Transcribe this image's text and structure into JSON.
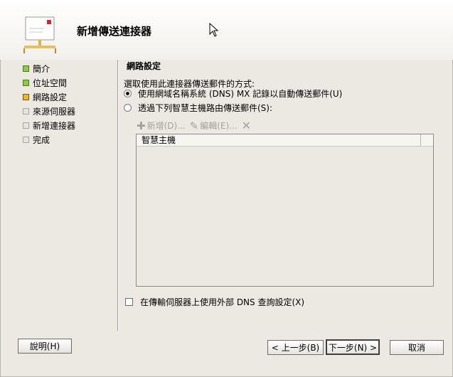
{
  "header": {
    "title": "新增傳送連接器"
  },
  "steps": [
    {
      "label": "簡介",
      "state": "done"
    },
    {
      "label": "位址空間",
      "state": "done"
    },
    {
      "label": "網路設定",
      "state": "current"
    },
    {
      "label": "來源伺服器",
      "state": "todo"
    },
    {
      "label": "新增連接器",
      "state": "todo"
    },
    {
      "label": "完成",
      "state": "todo"
    }
  ],
  "network": {
    "section_title": "網路設定",
    "prompt": "選取使用此連接器傳送郵件的方式:",
    "option_dns": "使用網域名稱系統 (DNS) MX 記錄以自動傳送郵件(U)",
    "option_smarthost": "透過下列智慧主機路由傳送郵件(S):",
    "selected_option": "dns",
    "toolbar": {
      "add_label": "新增(D)...",
      "edit_label": "編輯(E)..."
    },
    "list_header": "智慧主機",
    "external_dns_label": "在傳輸伺服器上使用外部 DNS 查詢設定(X)",
    "external_dns_checked": false
  },
  "buttons": {
    "help": "說明(H)",
    "back": "< 上一步(B)",
    "next": "下一步(N) >",
    "cancel": "取消"
  },
  "colors": {
    "done": "#8ccc44",
    "current": "#e8b830",
    "todo": "#e6e4de"
  }
}
